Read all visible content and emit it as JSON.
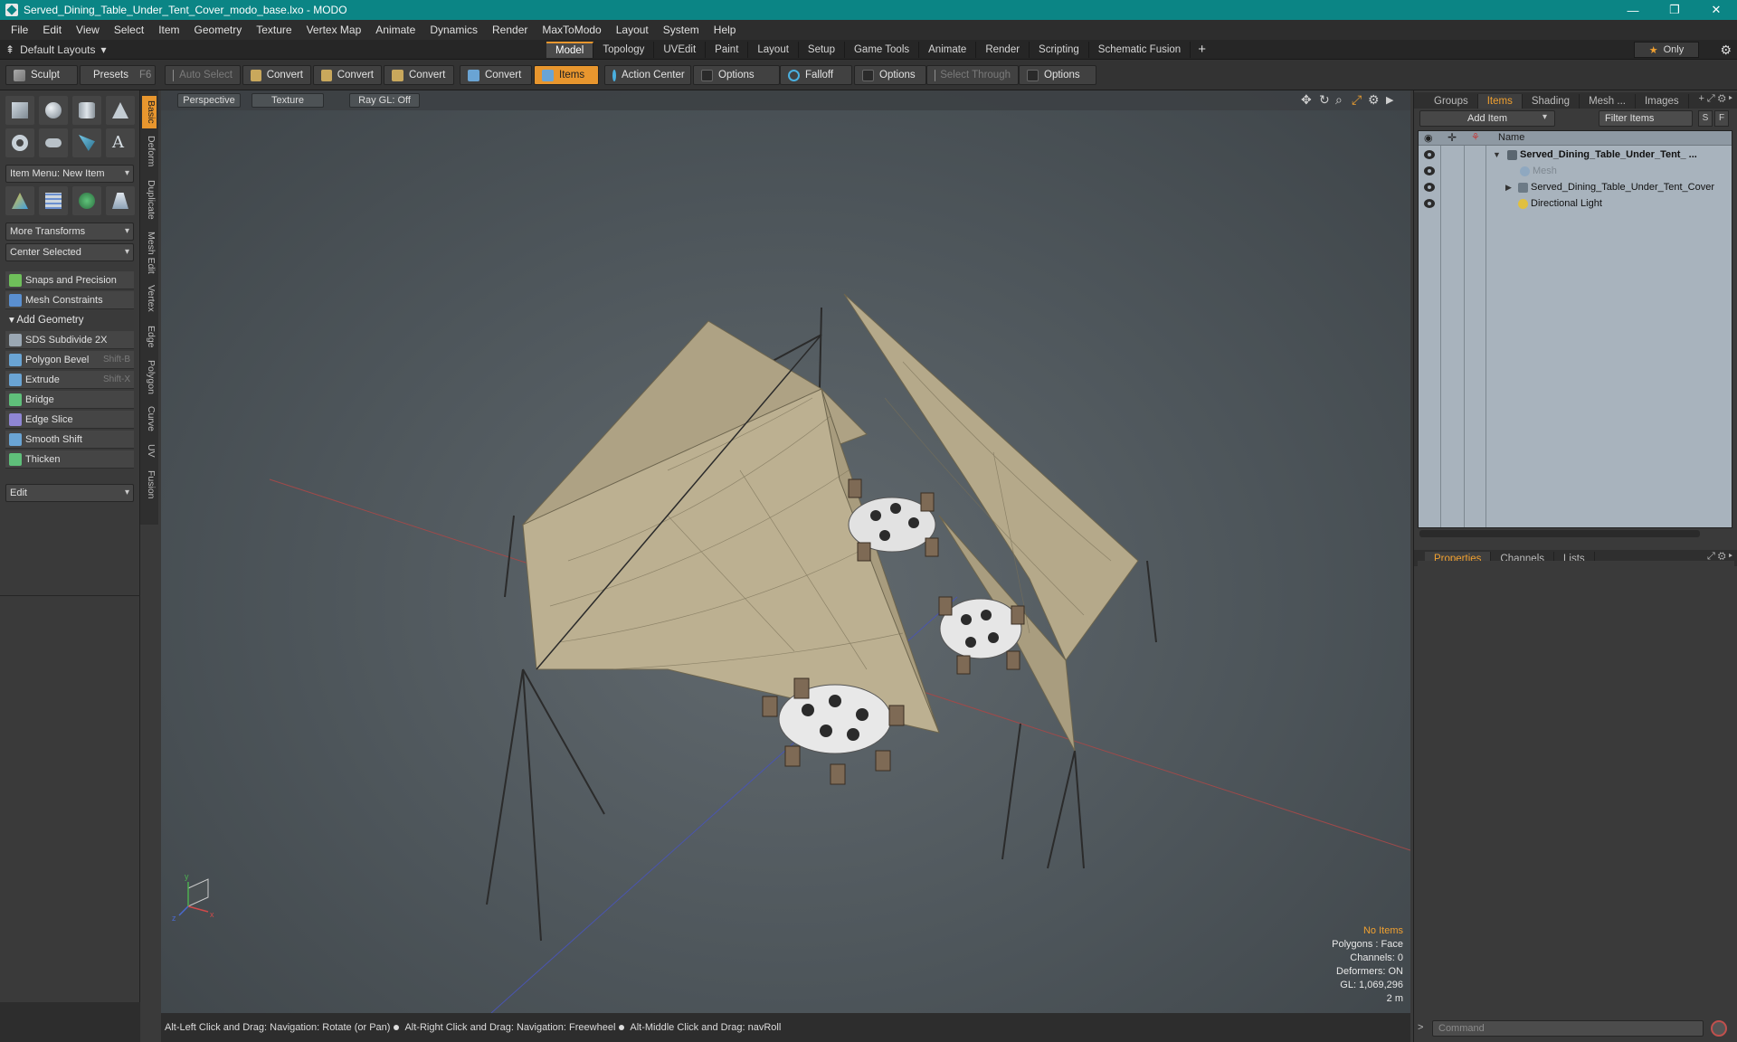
{
  "window": {
    "title": "Served_Dining_Table_Under_Tent_Cover_modo_base.lxo - MODO",
    "minimize": "—",
    "maximize": "❐",
    "close": "✕"
  },
  "menu": [
    "File",
    "Edit",
    "View",
    "Select",
    "Item",
    "Geometry",
    "Texture",
    "Vertex Map",
    "Animate",
    "Dynamics",
    "Render",
    "MaxToModo",
    "Layout",
    "System",
    "Help"
  ],
  "layouts": {
    "current": "Default Layouts",
    "tabs": [
      "Model",
      "Topology",
      "UVEdit",
      "Paint",
      "Layout",
      "Setup",
      "Game Tools",
      "Animate",
      "Render",
      "Scripting",
      "Schematic Fusion"
    ],
    "active_tab": "Model",
    "plus": "+",
    "only": "Only"
  },
  "toolbar": {
    "sculpt": "Sculpt",
    "presets": "Presets",
    "presets_key": "F6",
    "auto_select": "Auto Select",
    "convert1": "Convert",
    "convert2": "Convert",
    "convert3": "Convert",
    "convert4": "Convert",
    "items": "Items",
    "action_center": "Action Center",
    "options1": "Options",
    "falloff": "Falloff",
    "options2": "Options",
    "select_through": "Select Through",
    "options3": "Options"
  },
  "left_panel": {
    "item_menu": "Item Menu: New Item",
    "more_transforms": "More Transforms",
    "center_selected": "Center Selected",
    "snaps": "Snaps and Precision",
    "mesh_constraints": "Mesh Constraints",
    "add_geometry": "Add Geometry",
    "tools": [
      {
        "label": "SDS Subdivide 2X",
        "shortcut": ""
      },
      {
        "label": "Polygon Bevel",
        "shortcut": "Shift-B"
      },
      {
        "label": "Extrude",
        "shortcut": "Shift-X"
      },
      {
        "label": "Bridge",
        "shortcut": ""
      },
      {
        "label": "Edge Slice",
        "shortcut": ""
      },
      {
        "label": "Smooth Shift",
        "shortcut": ""
      },
      {
        "label": "Thicken",
        "shortcut": ""
      }
    ],
    "edit": "Edit",
    "vertical_tabs": [
      "Basic",
      "Deform",
      "Duplicate",
      "Mesh Edit",
      "Vertex",
      "Edge",
      "Polygon",
      "Curve",
      "UV",
      "Fusion"
    ]
  },
  "viewport": {
    "view": "Perspective",
    "shading": "Texture",
    "raygl": "Ray GL: Off",
    "stats": {
      "no_items": "No Items",
      "polygons": "Polygons : Face",
      "channels": "Channels: 0",
      "deformers": "Deformers: ON",
      "gl": "GL: 1,069,296",
      "scale": "2 m"
    },
    "axis": {
      "x": "x",
      "y": "y",
      "z": "z"
    }
  },
  "status": {
    "hint1": "Alt-Left Click and Drag: Navigation: Rotate (or Pan)",
    "hint2": "Alt-Right Click and Drag: Navigation: Freewheel",
    "hint3": "Alt-Middle Click and Drag: navRoll"
  },
  "right_panel": {
    "top_tabs": [
      "Groups",
      "Items",
      "Shading",
      "Mesh ...",
      "Images"
    ],
    "active_top_tab": "Items",
    "add_item": "Add Item",
    "filter_items": "Filter Items",
    "s": "S",
    "f": "F",
    "name_header": "Name",
    "items": [
      {
        "label": "Served_Dining_Table_Under_Tent_ ...",
        "selected": true
      },
      {
        "label": "Mesh",
        "dim": true
      },
      {
        "label": "Served_Dining_Table_Under_Tent_Cover"
      },
      {
        "label": "Directional Light"
      }
    ],
    "bottom_tabs": [
      "Properties",
      "Channels",
      "Lists"
    ],
    "active_bottom_tab": "Properties",
    "command_placeholder": "Command"
  },
  "colors": {
    "accent": "#e8962e",
    "titlebar": "#0b8585",
    "tent": "#b9ad8c"
  }
}
